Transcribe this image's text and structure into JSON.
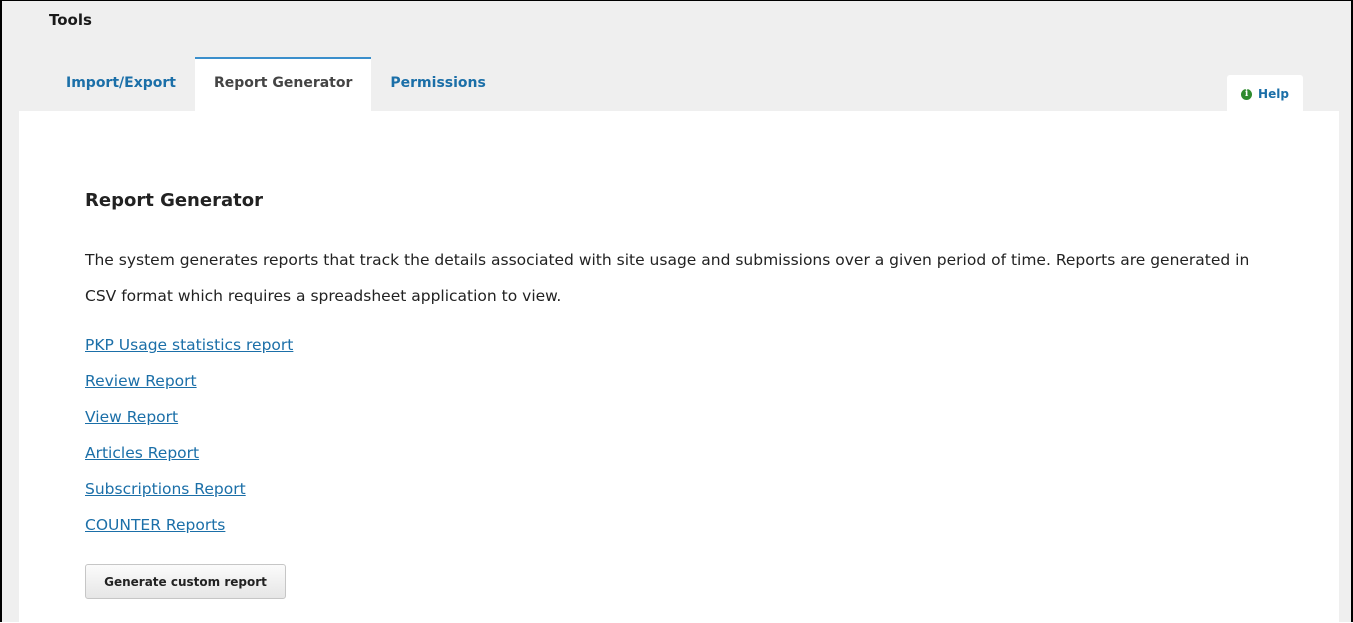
{
  "header": {
    "title": "Tools"
  },
  "tabs": [
    {
      "label": "Import/Export",
      "active": false
    },
    {
      "label": "Report Generator",
      "active": true
    },
    {
      "label": "Permissions",
      "active": false
    }
  ],
  "help": {
    "label": "Help",
    "icon": "info-icon",
    "icon_glyph": "i"
  },
  "main": {
    "heading": "Report Generator",
    "description": "The system generates reports that track the details associated with site usage and submissions over a given period of time. Reports are generated in CSV format which requires a spreadsheet application to view.",
    "links": [
      "PKP Usage statistics report",
      "Review Report",
      "View Report",
      "Articles Report",
      "Subscriptions Report",
      "COUNTER Reports"
    ],
    "button_label": "Generate custom report"
  },
  "colors": {
    "link": "#1b6fa8",
    "active_tab_border": "#3b8fcc",
    "background": "#efefef",
    "help_icon": "#2e8b2e"
  }
}
